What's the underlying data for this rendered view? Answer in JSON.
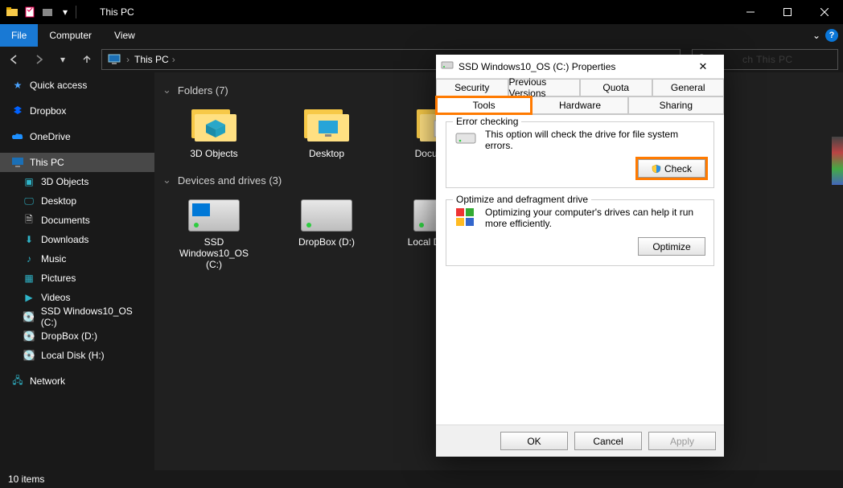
{
  "window": {
    "title": "This PC"
  },
  "ribbon": {
    "file": "File",
    "tabs": [
      "Computer",
      "View"
    ]
  },
  "address": {
    "location": "This PC"
  },
  "search": {
    "placeholder": "Search This PC"
  },
  "nav": {
    "items": [
      {
        "label": "Quick access",
        "icon": "star"
      },
      {
        "label": "Dropbox",
        "icon": "dropbox"
      },
      {
        "label": "OneDrive",
        "icon": "onedrive"
      },
      {
        "label": "This PC",
        "icon": "pc",
        "selected": true
      },
      {
        "label": "Network",
        "icon": "network"
      }
    ],
    "pc_children": [
      {
        "label": "3D Objects"
      },
      {
        "label": "Desktop"
      },
      {
        "label": "Documents"
      },
      {
        "label": "Downloads"
      },
      {
        "label": "Music"
      },
      {
        "label": "Pictures"
      },
      {
        "label": "Videos"
      },
      {
        "label": "SSD Windows10_OS (C:)"
      },
      {
        "label": "DropBox (D:)"
      },
      {
        "label": "Local Disk (H:)"
      }
    ]
  },
  "content": {
    "group1": {
      "header": "Folders (7)",
      "items": [
        {
          "label": "3D Objects"
        },
        {
          "label": "Desktop"
        },
        {
          "label": "Documents"
        }
      ]
    },
    "group2": {
      "header": "Devices and drives (3)",
      "items": [
        {
          "label": "SSD Windows10_OS (C:)"
        },
        {
          "label": "DropBox (D:)"
        },
        {
          "label": "Local Disk (H:)"
        }
      ]
    }
  },
  "status": {
    "text": "10 items"
  },
  "dialog": {
    "title": "SSD Windows10_OS (C:) Properties",
    "tabs_row1": [
      "Security",
      "Previous Versions",
      "Quota"
    ],
    "tabs_row2": [
      "General",
      "Tools",
      "Hardware",
      "Sharing"
    ],
    "active_tab": "Tools",
    "error_checking": {
      "title": "Error checking",
      "desc": "This option will check the drive for file system errors.",
      "button": "Check"
    },
    "optimize": {
      "title": "Optimize and defragment drive",
      "desc": "Optimizing your computer's drives can help it run more efficiently.",
      "button": "Optimize"
    },
    "buttons": {
      "ok": "OK",
      "cancel": "Cancel",
      "apply": "Apply"
    }
  }
}
